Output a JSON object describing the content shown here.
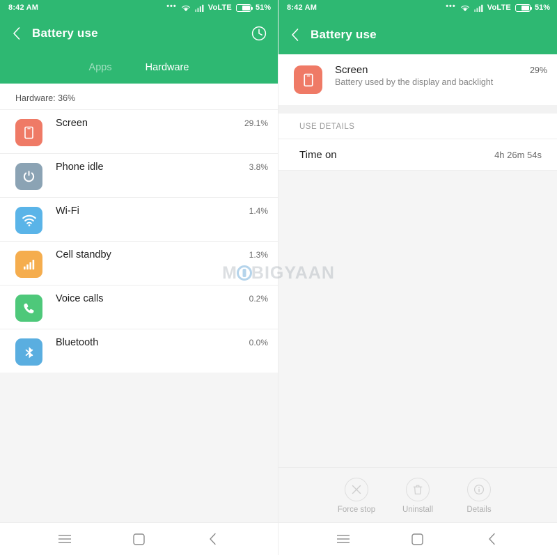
{
  "status_bar": {
    "time": "8:42 AM",
    "dots_icon": "more-dots-icon",
    "wifi_icon": "wifi-icon",
    "signal_icon": "cellular-signal-icon",
    "network_label": "VoLTE",
    "battery_icon": "battery-icon",
    "battery_percent": "51%"
  },
  "colors": {
    "header_green": "#2eb872",
    "progress_blue": "#2a9fe0",
    "track_gray": "#e8e8e8",
    "screen_icon": "#ef7a66",
    "phone_idle_icon": "#8ba3b4",
    "wifi_icon": "#5ab4e8",
    "cell_standby_icon": "#f5ad4e",
    "voice_calls_icon": "#4ec87a",
    "bluetooth_icon": "#5aaee0"
  },
  "left_panel": {
    "appbar": {
      "back_icon": "back-chevron-icon",
      "title": "Battery use",
      "history_icon": "clock-history-icon"
    },
    "tabs": [
      {
        "label": "Apps",
        "active": false
      },
      {
        "label": "Hardware",
        "active": true
      }
    ],
    "summary": "Hardware: 36%",
    "items": [
      {
        "label": "Screen",
        "percent": "29.1%",
        "bar": 29.1,
        "icon": "screen-icon",
        "icon_color": "#ef7a66"
      },
      {
        "label": "Phone idle",
        "percent": "3.8%",
        "bar": 3.8,
        "icon": "power-icon",
        "icon_color": "#8ba3b4"
      },
      {
        "label": "Wi-Fi",
        "percent": "1.4%",
        "bar": 1.4,
        "icon": "wifi-icon",
        "icon_color": "#5ab4e8"
      },
      {
        "label": "Cell standby",
        "percent": "1.3%",
        "bar": 1.3,
        "icon": "signal-bars-icon",
        "icon_color": "#f5ad4e"
      },
      {
        "label": "Voice calls",
        "percent": "0.2%",
        "bar": 0.2,
        "icon": "phone-call-icon",
        "icon_color": "#4ec87a"
      },
      {
        "label": "Bluetooth",
        "percent": "0.0%",
        "bar": 0.0,
        "icon": "bluetooth-icon",
        "icon_color": "#5aaee0"
      }
    ]
  },
  "right_panel": {
    "appbar": {
      "back_icon": "back-chevron-icon",
      "title": "Battery use"
    },
    "detail_header": {
      "name": "Screen",
      "description": "Battery used by the display and backlight",
      "percent": "29%",
      "bar": 29,
      "icon": "screen-icon",
      "icon_color": "#ef7a66"
    },
    "section_title": "USE DETAILS",
    "details": [
      {
        "key": "Time on",
        "value": "4h 26m 54s"
      }
    ],
    "actions": [
      {
        "label": "Force stop",
        "icon": "close-x-icon"
      },
      {
        "label": "Uninstall",
        "icon": "trash-icon"
      },
      {
        "label": "Details",
        "icon": "info-icon"
      }
    ]
  },
  "nav_bar": {
    "menu_icon": "menu-icon",
    "home_icon": "home-square-icon",
    "back_icon": "back-chevron-icon"
  },
  "watermark": {
    "text_before": "M",
    "text_after": "BIGYAAN"
  }
}
